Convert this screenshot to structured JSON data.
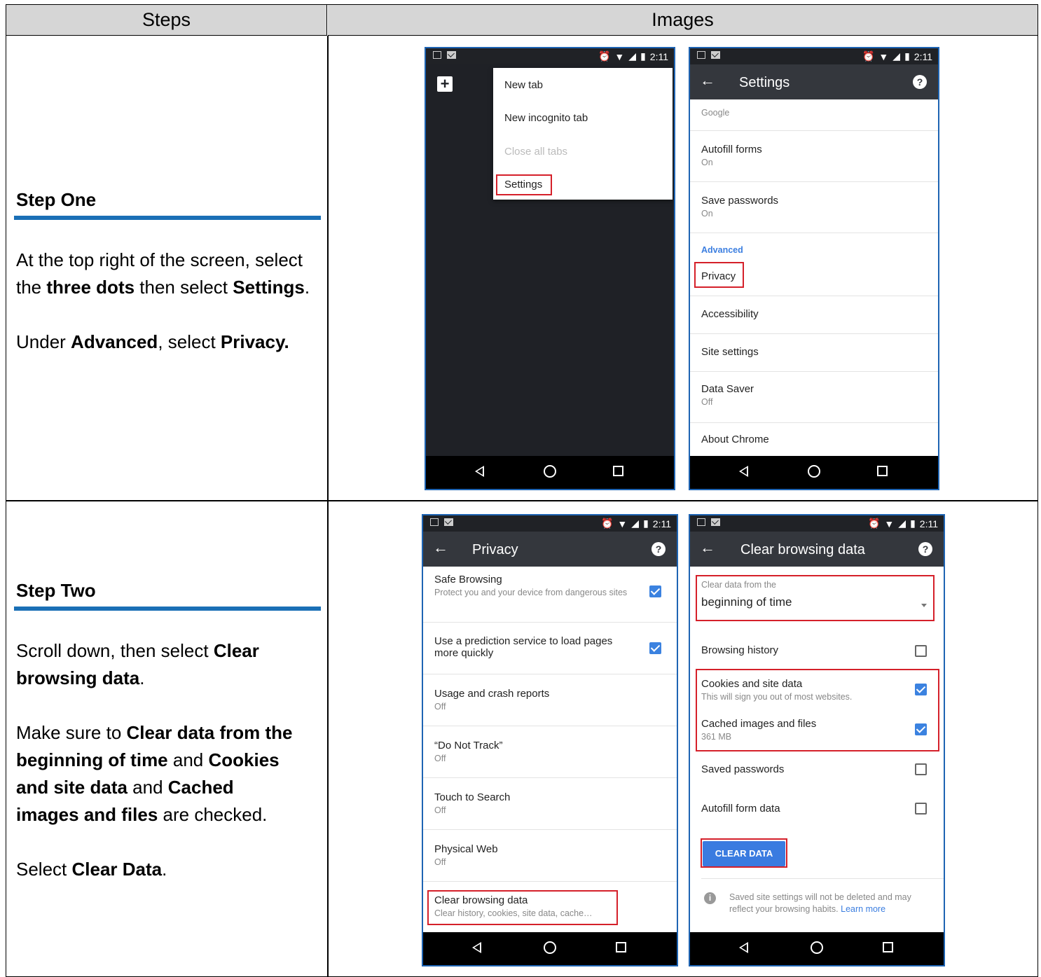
{
  "table": {
    "header_steps": "Steps",
    "header_images": "Images"
  },
  "step_one": {
    "title": "Step One",
    "p1_a": "At the top right of the screen, select the ",
    "p1_b": "three dots",
    "p1_c": " then select ",
    "p1_d": "Settings",
    "p1_e": ".",
    "p2_a": "Under ",
    "p2_b": "Advanced",
    "p2_c": ", select ",
    "p2_d": "Privacy."
  },
  "step_two": {
    "title": "Step Two",
    "p1_a": "Scroll down, then select ",
    "p1_b": "Clear browsing data",
    "p1_c": ".",
    "p2_a": "Make sure to ",
    "p2_b": "Clear data from the beginning of time",
    "p2_c": " and ",
    "p2_d": "Cookies and site data",
    "p2_e": " and ",
    "p2_f": "Cached images and files",
    "p2_g": " are checked.",
    "p3_a": "Select ",
    "p3_b": "Clear Data",
    "p3_c": "."
  },
  "status": {
    "time": "2:11"
  },
  "phone_menu": {
    "items": [
      "New tab",
      "New incognito tab",
      "Close all tabs",
      "Settings"
    ]
  },
  "phone_settings": {
    "title": "Settings",
    "top_partial": "Google",
    "autofill": "Autofill forms",
    "autofill_sub": "On",
    "passwords": "Save passwords",
    "passwords_sub": "On",
    "section": "Advanced",
    "privacy": "Privacy",
    "accessibility": "Accessibility",
    "site_settings": "Site settings",
    "data_saver": "Data Saver",
    "data_saver_sub": "Off",
    "about": "About Chrome"
  },
  "phone_privacy": {
    "title": "Privacy",
    "safe": "Safe Browsing",
    "safe_sub": "Protect you and your device from dangerous sites",
    "predict": "Use a prediction service to load pages more quickly",
    "usage": "Usage and crash reports",
    "usage_sub": "Off",
    "dnt": "“Do Not Track”",
    "dnt_sub": "Off",
    "touch": "Touch to Search",
    "touch_sub": "Off",
    "physical": "Physical Web",
    "physical_sub": "Off",
    "clear": "Clear browsing data",
    "clear_sub": "Clear history, cookies, site data, cache…"
  },
  "phone_clear": {
    "title": "Clear browsing data",
    "range_label": "Clear data from the",
    "range_value": "beginning of time",
    "history": "Browsing history",
    "cookies": "Cookies and site data",
    "cookies_sub": "This will sign you out of most websites.",
    "cache": "Cached images and files",
    "cache_sub": "361 MB",
    "saved_pw": "Saved passwords",
    "autofill": "Autofill form data",
    "button": "CLEAR DATA",
    "note": "Saved site settings will not be deleted and may reflect your browsing habits.",
    "learn_more": "Learn more"
  }
}
